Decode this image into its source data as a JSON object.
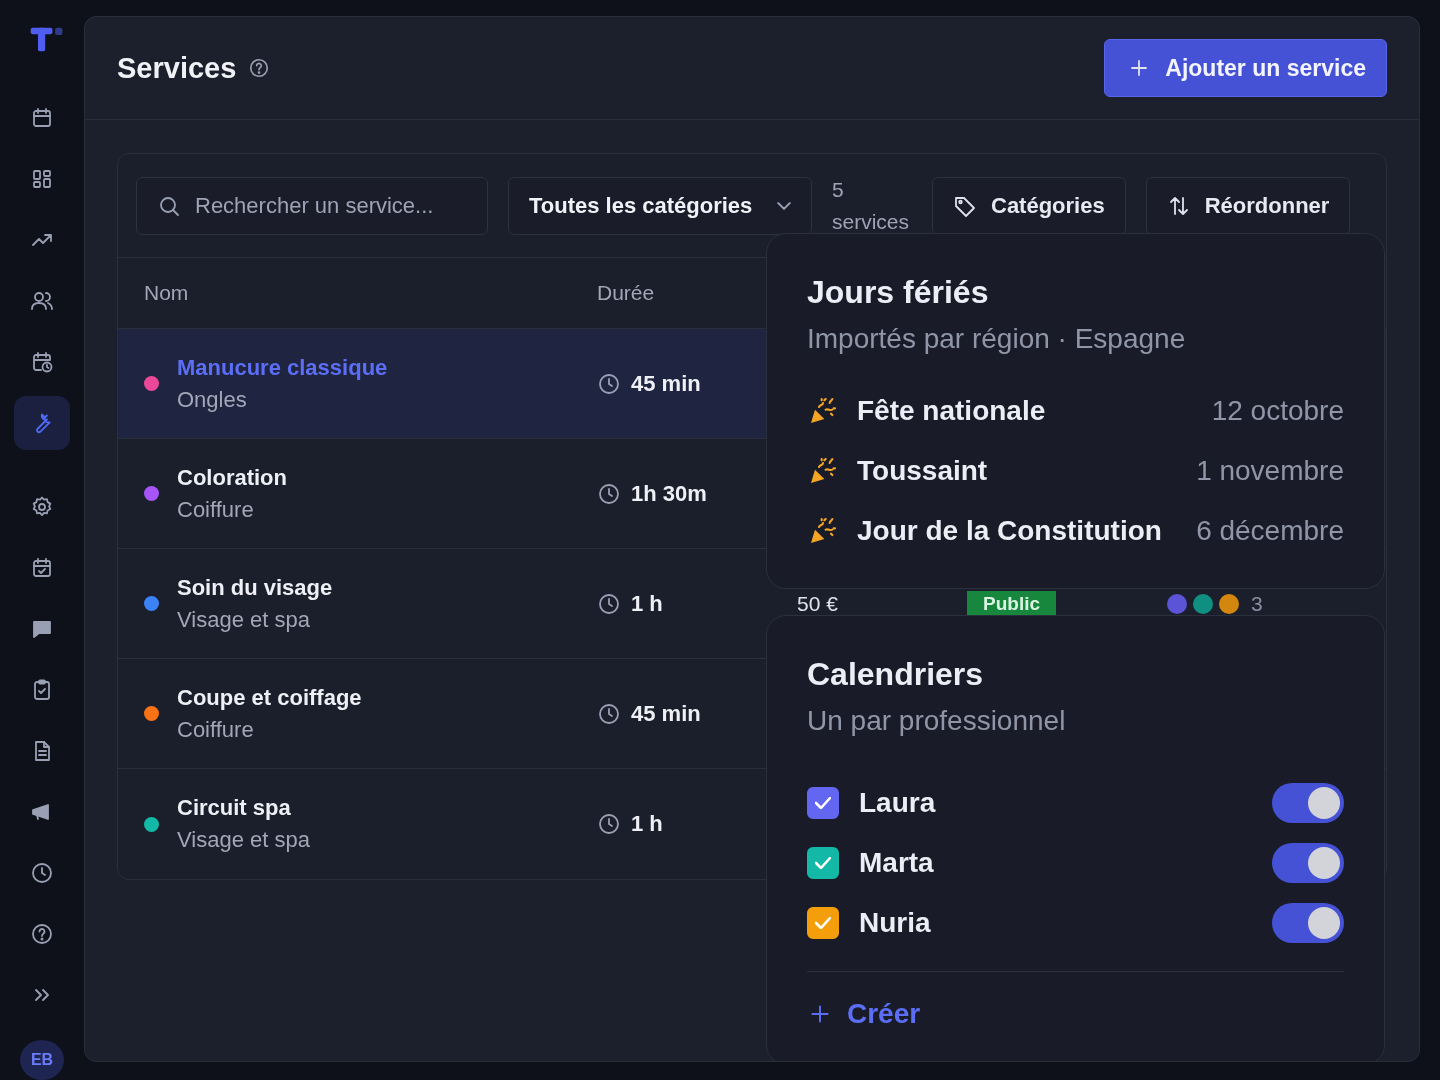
{
  "sidebar": {
    "nav_primary": [
      {
        "kind": "calendar",
        "selected": false
      },
      {
        "kind": "grid",
        "selected": false
      },
      {
        "kind": "trend",
        "selected": false
      },
      {
        "kind": "users",
        "selected": false
      },
      {
        "kind": "schedule",
        "selected": false
      },
      {
        "kind": "wrench",
        "selected": true
      }
    ],
    "nav_secondary": [
      {
        "kind": "gear",
        "selected": false
      },
      {
        "kind": "calcheck",
        "selected": false
      },
      {
        "kind": "chat",
        "selected": false
      },
      {
        "kind": "clipboard",
        "selected": false
      },
      {
        "kind": "document",
        "selected": false
      },
      {
        "kind": "megaphone",
        "selected": false
      },
      {
        "kind": "clock",
        "selected": false
      },
      {
        "kind": "help",
        "selected": false
      },
      {
        "kind": "expand",
        "selected": false
      }
    ],
    "avatar": "EB"
  },
  "header": {
    "title": "Services",
    "add_button": "Ajouter un service"
  },
  "toolbar": {
    "search": {
      "placeholder": "Rechercher un service..."
    },
    "category_filter": "Toutes les catégories",
    "count": "5 services",
    "categories_button": "Catégories",
    "reorder_button": "Réordonner"
  },
  "table": {
    "columns": [
      "Nom",
      "Durée"
    ],
    "rows": [
      {
        "name": "Manucure classique",
        "category": "Ongles",
        "color": "#ec4899",
        "duration": "45 min",
        "selected": true
      },
      {
        "name": "Coloration",
        "category": "Coiffure",
        "color": "#a855f7",
        "duration": "1h 30m",
        "selected": false
      },
      {
        "name": "Soin du visage",
        "category": "Visage et spa",
        "color": "#3b82f6",
        "duration": "1 h",
        "selected": false,
        "price": "50 €",
        "visibility": "Public",
        "staff": {
          "members": [
            {
              "color": "#5b54d6"
            },
            {
              "color": "#0f8f80"
            },
            {
              "color": "#d4870f"
            }
          ],
          "count": "3"
        }
      },
      {
        "name": "Coupe et coiffage",
        "category": "Coiffure",
        "color": "#f97316",
        "duration": "45 min",
        "selected": false
      },
      {
        "name": "Circuit spa",
        "category": "Visage et spa",
        "color": "#14b8a6",
        "duration": "1 h",
        "selected": false
      }
    ]
  },
  "holidays_popover": {
    "title": "Jours fériés",
    "subtitle": "Importés par région · Espagne",
    "items": [
      {
        "name": "Fête nationale",
        "date": "12 octobre"
      },
      {
        "name": "Toussaint",
        "date": "1 novembre"
      },
      {
        "name": "Jour de la Constitution",
        "date": "6 décembre"
      }
    ]
  },
  "calendars_popover": {
    "title": "Calendriers",
    "subtitle": "Un par professionnel",
    "items": [
      {
        "name": "Laura",
        "color": "#6366f1",
        "checked": true,
        "on": true
      },
      {
        "name": "Marta",
        "color": "#14b8a6",
        "checked": true,
        "on": true
      },
      {
        "name": "Nuria",
        "color": "#f59e0b",
        "checked": true,
        "on": true
      }
    ],
    "create_link": "Créer"
  }
}
